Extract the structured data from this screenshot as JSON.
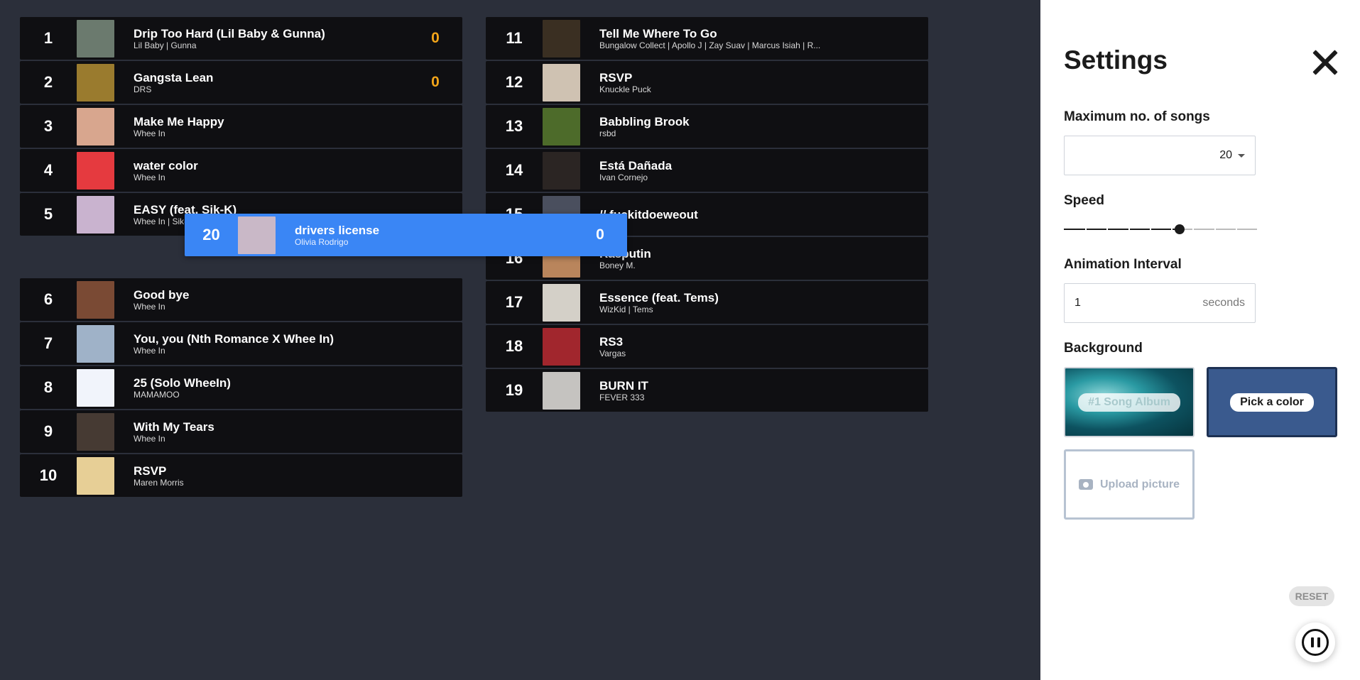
{
  "chart": {
    "rows": [
      {
        "rank": "1",
        "title": "Drip Too Hard (Lil Baby & Gunna)",
        "artist": "Lil Baby | Gunna",
        "score": "0",
        "art": "#6b7a6e"
      },
      {
        "rank": "2",
        "title": "Gangsta Lean",
        "artist": "DRS",
        "score": "0",
        "art": "#9a7b2e"
      },
      {
        "rank": "3",
        "title": "Make Me Happy",
        "artist": "Whee In",
        "score": "",
        "art": "#d8a68e"
      },
      {
        "rank": "4",
        "title": "water color",
        "artist": "Whee In",
        "score": "",
        "art": "#e53a3f"
      },
      {
        "rank": "5",
        "title": "EASY (feat. Sik-K)",
        "artist": "Whee In | Sik-K",
        "score": "",
        "art": "#c9b3cf"
      },
      {
        "rank": "6",
        "title": "Good bye",
        "artist": "Whee In",
        "score": "",
        "art": "#7a4a34"
      },
      {
        "rank": "7",
        "title": "You, you (Nth Romance X Whee In)",
        "artist": "Whee In",
        "score": "",
        "art": "#9fb2c8"
      },
      {
        "rank": "8",
        "title": "25 (Solo WheeIn)",
        "artist": "MAMAMOO",
        "score": "",
        "art": "#f1f4fb"
      },
      {
        "rank": "9",
        "title": "With My Tears",
        "artist": "Whee In",
        "score": "",
        "art": "#463a33"
      },
      {
        "rank": "10",
        "title": "RSVP",
        "artist": "Maren Morris",
        "score": "",
        "art": "#e7cf96"
      },
      {
        "rank": "11",
        "title": "Tell Me Where To Go",
        "artist": "Bungalow Collect | Apollo J | Zay Suav | Marcus Isiah | R...",
        "score": "",
        "art": "#3a2f22"
      },
      {
        "rank": "12",
        "title": "RSVP",
        "artist": "Knuckle Puck",
        "score": "",
        "art": "#cfc2b2"
      },
      {
        "rank": "13",
        "title": "Babbling Brook",
        "artist": "rsbd",
        "score": "",
        "art": "#4d6b2a"
      },
      {
        "rank": "14",
        "title": "Está Dañada",
        "artist": "Ivan Cornejo",
        "score": "",
        "art": "#2b2523"
      },
      {
        "rank": "15",
        "title": "// fuckitdoeweout",
        "artist": "",
        "score": "",
        "art": "#4a4f5e"
      },
      {
        "rank": "16",
        "title": "Rasputin",
        "artist": "Boney M.",
        "score": "",
        "art": "#b9855c"
      },
      {
        "rank": "17",
        "title": "Essence (feat. Tems)",
        "artist": "WizKid | Tems",
        "score": "",
        "art": "#d4d0c8"
      },
      {
        "rank": "18",
        "title": "RS3",
        "artist": "Vargas",
        "score": "",
        "art": "#a1262d"
      },
      {
        "rank": "19",
        "title": "BURN IT",
        "artist": "FEVER 333",
        "score": "",
        "art": "#c5c3c0"
      }
    ],
    "moving": {
      "rank": "20",
      "title": "drivers license",
      "artist": "Olivia Rodrigo",
      "score": "0",
      "art": "#c9b8c7"
    }
  },
  "settings": {
    "title": "Settings",
    "max_songs_label": "Maximum no. of songs",
    "max_songs_value": "20",
    "speed_label": "Speed",
    "speed_level": 0.6,
    "interval_label": "Animation Interval",
    "interval_value": "1",
    "interval_unit": "seconds",
    "background_label": "Background",
    "bg_album_label": "#1 Song Album",
    "bg_color_label": "Pick a color",
    "bg_upload_label": "Upload picture",
    "reset_label": "RESET"
  }
}
